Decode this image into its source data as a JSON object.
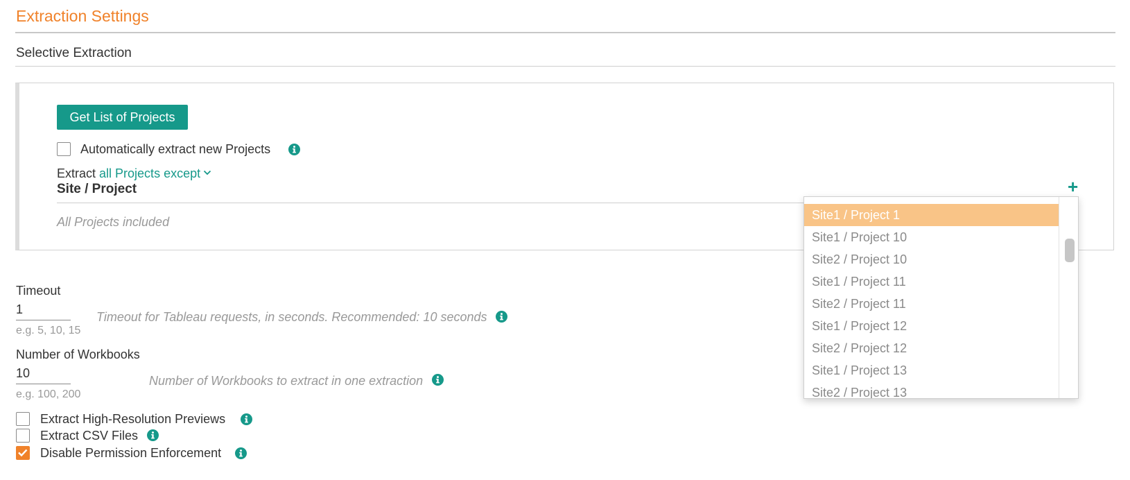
{
  "header": {
    "title": "Extraction Settings",
    "section": "Selective Extraction"
  },
  "projects": {
    "get_button_label": "Get List of Projects",
    "auto_extract_label": "Automatically extract new Projects",
    "auto_extract_checked": false,
    "extract_prefix": "Extract",
    "extract_mode": "all Projects except",
    "column_header": "Site / Project",
    "empty_note": "All Projects included",
    "add_icon": "plus-icon"
  },
  "dropdown": {
    "items": [
      "Site1 / Project 1",
      "Site1 / Project 10",
      "Site2 / Project 10",
      "Site1 / Project 11",
      "Site2 / Project 11",
      "Site1 / Project 12",
      "Site2 / Project 12",
      "Site1 / Project 13",
      "Site2 / Project 13"
    ],
    "selected_index": 0
  },
  "timeout": {
    "label": "Timeout",
    "value": "1",
    "hint": "e.g. 5, 10, 15",
    "description": "Timeout for Tableau requests, in seconds. Recommended: 10 seconds"
  },
  "workbooks": {
    "label": "Number of Workbooks",
    "value": "10",
    "hint": "e.g. 100, 200",
    "description": "Number of Workbooks to extract in one extraction"
  },
  "options": [
    {
      "label": "Extract High-Resolution Previews",
      "checked": false
    },
    {
      "label": "Extract CSV Files",
      "checked": false
    },
    {
      "label": "Disable Permission Enforcement",
      "checked": true
    }
  ],
  "colors": {
    "accent_orange": "#f0822a",
    "accent_teal": "#16998a",
    "selected_item": "#f9c487"
  }
}
